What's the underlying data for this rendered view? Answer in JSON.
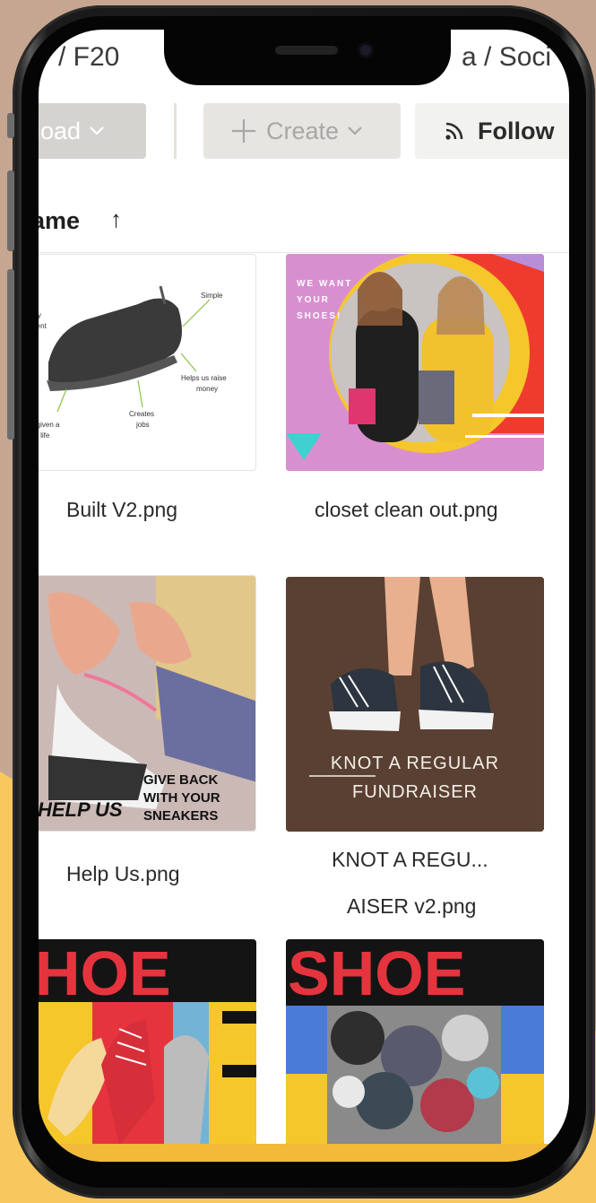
{
  "breadcrumb": {
    "left_fragment": "/ F20",
    "right_fragment": "a / Soci"
  },
  "toolbar": {
    "upload_label": "load",
    "create_label": "Create",
    "follow_label": "Follow"
  },
  "sort": {
    "label": "ame",
    "direction_glyph": "↑"
  },
  "files": [
    {
      "caption": "Built V2.png"
    },
    {
      "caption": "closet clean out.png",
      "thumb_text": [
        "WE WANT",
        "YOUR",
        "SHOES!"
      ]
    },
    {
      "caption": "Help Us.png",
      "thumb_text": [
        "GIVE BACK",
        "WITH YOUR",
        "SNEAKERS",
        "HELP US"
      ]
    },
    {
      "caption_line1": "KNOT A REGU...",
      "caption_line2": "AISER v2.png",
      "thumb_text": [
        "KNOT A REGULAR",
        "FUNDRAISER"
      ]
    },
    {
      "thumb_text": [
        "HOE"
      ]
    },
    {
      "thumb_text": [
        "SHOE"
      ]
    }
  ],
  "sneaker_diagram_labels": [
    "Simple",
    "sity",
    "ment",
    "Helps us raise",
    "money",
    "Creates",
    "jobs",
    "e given a",
    "nd life"
  ],
  "colors": {
    "background": "#c6a690",
    "accent_yellow": "#f8c85e",
    "upload_bg": "#d5d3cf",
    "create_bg": "#e6e5e2",
    "follow_bg": "#f2f2f1"
  }
}
